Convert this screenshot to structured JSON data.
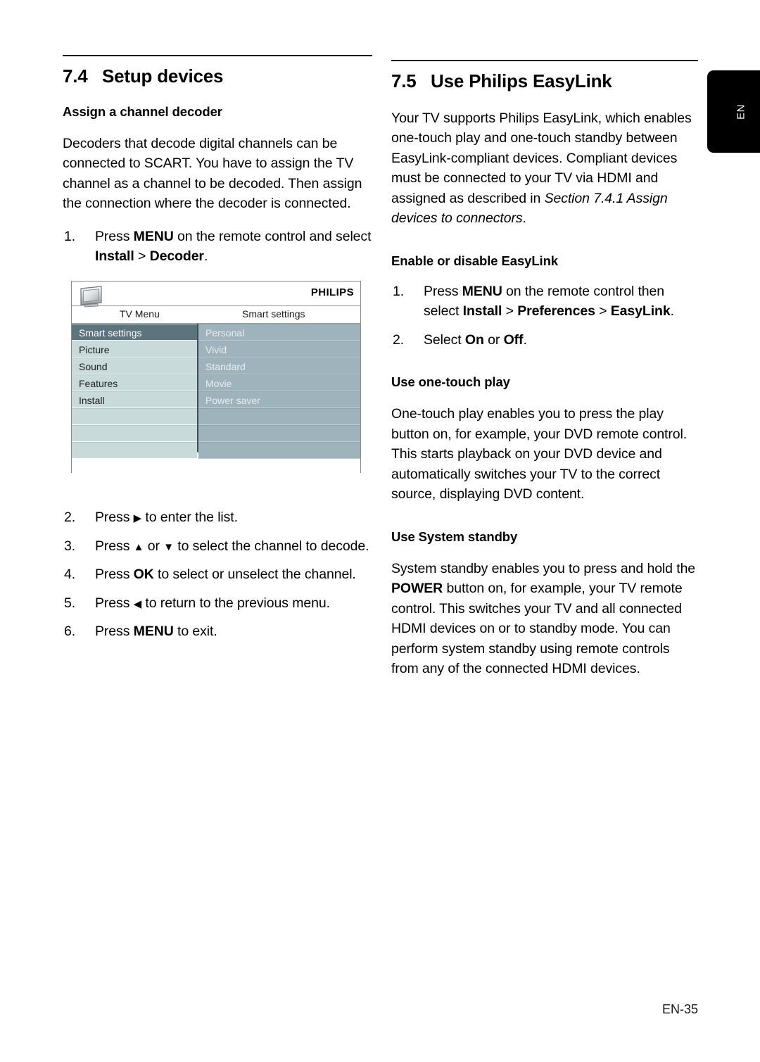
{
  "language_tab": {
    "label": "EN"
  },
  "footer": {
    "page_number": "EN-35"
  },
  "left_column": {
    "section": {
      "number": "7.4",
      "title": "Setup devices"
    },
    "subheading": "Assign a channel decoder",
    "intro_paragraph": "Decoders that decode digital channels can be connected to SCART. You have to assign the TV channel as a channel to be decoded. Then assign the connection where the decoder is connected.",
    "step1": {
      "marker": "1.",
      "part1": "Press ",
      "bold1": "MENU",
      "part2": " on the remote control and select ",
      "bold2": "Install",
      "part3": " > ",
      "bold3": "Decoder",
      "part4": "."
    },
    "step2": {
      "marker": "2.",
      "part1": "Press ",
      "icon": "▶",
      "part2": " to enter the list."
    },
    "step3": {
      "marker": "3.",
      "part1": "Press ",
      "icon_up": "▲",
      "part2": " or ",
      "icon_down": "▼",
      "part3": " to select the channel to decode."
    },
    "step4": {
      "marker": "4.",
      "part1": "Press ",
      "bold1": "OK",
      "part2": " to select or unselect the channel."
    },
    "step5": {
      "marker": "5.",
      "part1": "Press ",
      "icon": "◀",
      "part2": " to return to the previous menu."
    },
    "step6": {
      "marker": "6.",
      "part1": "Press ",
      "bold1": "MENU",
      "part2": " to exit."
    }
  },
  "tv_menu_screenshot": {
    "brand": "PHILIPS",
    "title_left": "TV Menu",
    "title_right": "Smart settings",
    "left_items": [
      {
        "label": "Smart settings",
        "selected": true
      },
      {
        "label": "Picture",
        "selected": false
      },
      {
        "label": "Sound",
        "selected": false
      },
      {
        "label": "Features",
        "selected": false
      },
      {
        "label": "Install",
        "selected": false
      },
      {
        "label": "",
        "selected": false
      },
      {
        "label": "",
        "selected": false
      },
      {
        "label": "",
        "selected": false
      }
    ],
    "right_items": [
      {
        "label": "Personal"
      },
      {
        "label": "Vivid"
      },
      {
        "label": "Standard"
      },
      {
        "label": "Movie"
      },
      {
        "label": "Power saver"
      },
      {
        "label": ""
      },
      {
        "label": ""
      },
      {
        "label": ""
      }
    ]
  },
  "right_column": {
    "section": {
      "number": "7.5",
      "title": "Use Philips EasyLink"
    },
    "intro": {
      "part1": "Your TV supports Philips EasyLink, which enables one-touch play and one-touch standby between EasyLink-compliant devices. Compliant devices must be connected to your TV via HDMI and assigned as described in ",
      "italic1": "Section 7.4.1 Assign devices to connectors",
      "part2": "."
    },
    "enable_heading": "Enable or disable EasyLink",
    "enable_step1": {
      "marker": "1.",
      "part1": "Press ",
      "bold1": "MENU",
      "part2": " on the remote control then select ",
      "bold2": "Install",
      "part3": " > ",
      "bold3": "Preferences",
      "part4": " > ",
      "bold4": "EasyLink",
      "part5": "."
    },
    "enable_step2": {
      "marker": "2.",
      "part1": "Select ",
      "bold1": "On",
      "part2": " or ",
      "bold2": "Off",
      "part3": "."
    },
    "one_touch_heading": "Use one-touch play",
    "one_touch_paragraph": "One-touch play enables you to press the play button on, for example, your DVD remote control. This starts playback on your DVD device and automatically switches your TV to the correct source, displaying DVD content.",
    "standby_heading": "Use System standby",
    "standby_paragraph": {
      "part1": "System standby enables you to press and hold the ",
      "bold1": "POWER",
      "part2": " button on, for example, your TV remote control. This switches your TV and all connected HDMI devices on or to standby mode. You can perform system standby using remote controls from any of the connected HDMI devices."
    }
  }
}
